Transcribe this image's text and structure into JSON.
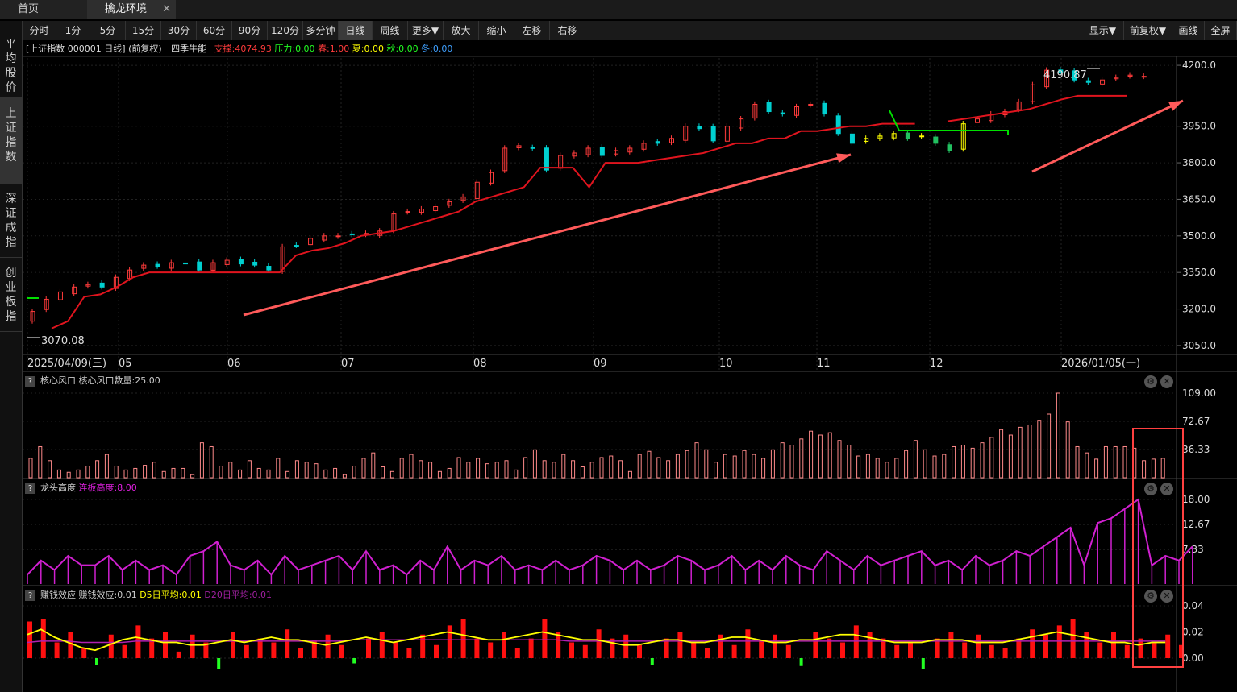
{
  "tabs": {
    "home": "首页",
    "active": "擒龙环境",
    "close": "✕"
  },
  "toolbar": {
    "left": [
      "分时",
      "1分",
      "5分",
      "15分",
      "30分",
      "60分",
      "90分",
      "120分",
      "多分钟",
      "日线",
      "周线",
      "更多▼",
      "放大",
      "缩小",
      "左移",
      "右移"
    ],
    "active": "日线",
    "right": [
      "显示▼",
      "前复权▼",
      "画线",
      "全屏"
    ]
  },
  "sidebar": [
    "平均股价",
    "上证指数",
    "深证成指",
    "创业板指"
  ],
  "sidebar_active": "上证指数",
  "main": {
    "title": "[上证指数 000001 日线] (前复权)",
    "indicator": "四季牛能",
    "support": "支撑:4074.93",
    "pressure": "压力:0.00",
    "spring": "春:1.00",
    "summer": "夏:0.00",
    "autumn": "秋:0.00",
    "winter": "冬:0.00",
    "high_label": "4190.87",
    "low_label": "3070.08",
    "y_ticks": [
      "4200.0",
      "3950.0",
      "3800.0",
      "3650.0",
      "3500.0",
      "3350.0",
      "3200.0",
      "3050.0"
    ],
    "dates": [
      "2025/04/09(三)",
      "05",
      "06",
      "07",
      "08",
      "09",
      "10",
      "11",
      "12",
      "2026/01/05(一)"
    ]
  },
  "panel1": {
    "name": "核心风口",
    "value": "核心风口数量:25.00",
    "y_ticks": [
      "109.00",
      "72.67",
      "36.33"
    ]
  },
  "panel2": {
    "name": "龙头高度",
    "value": "连板高度:8.00",
    "y_ticks": [
      "18.00",
      "12.67",
      "7.33"
    ]
  },
  "panel3": {
    "name": "赚钱效应",
    "v1": "赚钱效应:0.01",
    "v2": "D5日平均:0.01",
    "v3": "D20日平均:0.01",
    "y_ticks": [
      "0.04",
      "0.02",
      "0.00"
    ]
  },
  "help": "?",
  "icons": {
    "gear": "gear-icon",
    "close": "close-icon",
    "arrow": "arrow-left-icon"
  },
  "colors": {
    "up": "#ff3b3b",
    "down": "#00d0d0",
    "support": "#e0141e",
    "pressure": "#00e000",
    "spring": "#ff3b3b",
    "yellow": "#ffff00",
    "magenta": "#d020d0",
    "panel1": "#ff8a8a",
    "pink": "#ff6060",
    "green": "#22ff22"
  },
  "chart_data": [
    {
      "type": "candlestick",
      "title": "上证指数 000001 日线",
      "ylim": [
        3020,
        4230
      ],
      "x_labels": [
        "2025/04/09(三)",
        "05",
        "06",
        "07",
        "08",
        "09",
        "10",
        "11",
        "12",
        "2026/01/05(一)"
      ],
      "series": [
        {
          "name": "收盘价(近似)",
          "values": [
            3190,
            3240,
            3270,
            3290,
            3300,
            3290,
            3330,
            3360,
            3380,
            3375,
            3390,
            3385,
            3360,
            3390,
            3400,
            3385,
            3380,
            3360,
            3455,
            3460,
            3490,
            3500,
            3500,
            3505,
            3510,
            3520,
            3590,
            3600,
            3610,
            3620,
            3640,
            3660,
            3720,
            3760,
            3860,
            3870,
            3860,
            3770,
            3830,
            3840,
            3860,
            3830,
            3850,
            3860,
            3880,
            3880,
            3900,
            3950,
            3940,
            3890,
            3950,
            3980,
            4040,
            4010,
            4000,
            4030,
            4040,
            4000,
            3920,
            3880,
            3900,
            3910,
            3920,
            3900,
            3910,
            3880,
            3850,
            3960,
            3980,
            4000,
            4010,
            4050,
            4120,
            4180,
            4170,
            4140,
            4130,
            4140,
            4150,
            4160,
            4155
          ]
        },
        {
          "name": "四季牛能支撑",
          "values": [
            3120,
            3150,
            3250,
            3260,
            3290,
            3330,
            3350,
            3350,
            3350,
            3350,
            3350,
            3350,
            3350,
            3350,
            3350,
            3420,
            3440,
            3450,
            3470,
            3500,
            3510,
            3520,
            3540,
            3560,
            3580,
            3600,
            3640,
            3660,
            3680,
            3700,
            3780,
            3780,
            3780,
            3700,
            3800,
            3800,
            3800,
            3810,
            3820,
            3830,
            3840,
            3860,
            3880,
            3880,
            3900,
            3900,
            3930,
            3930,
            3940,
            3950,
            3950,
            3960,
            3960,
            3960,
            3970,
            3970,
            3980,
            3990,
            4000,
            4010,
            4020,
            4040,
            4060,
            4075,
            4075,
            4075,
            4075
          ]
        }
      ]
    },
    {
      "type": "bar",
      "title": "核心风口",
      "ylim": [
        0,
        109
      ],
      "values": [
        25,
        40,
        22,
        10,
        7,
        10,
        15,
        22,
        30,
        15,
        10,
        12,
        16,
        20,
        8,
        12,
        12,
        4,
        45,
        40,
        15,
        20,
        10,
        22,
        12,
        10,
        25,
        8,
        22,
        20,
        18,
        10,
        12,
        4,
        15,
        25,
        32,
        14,
        8,
        25,
        30,
        22,
        20,
        8,
        12,
        26,
        20,
        25,
        18,
        20,
        22,
        10,
        26,
        36,
        22,
        20,
        30,
        22,
        14,
        20,
        26,
        28,
        22,
        8,
        30,
        34,
        26,
        22,
        30,
        35,
        45,
        36,
        20,
        30,
        28,
        35,
        30,
        25,
        36,
        45,
        42,
        50,
        60,
        55,
        58,
        48,
        42,
        28,
        30,
        25,
        20,
        25,
        35,
        48,
        36,
        28,
        30,
        40,
        42,
        38,
        45,
        52,
        62,
        55,
        65,
        68,
        74,
        82,
        109,
        72,
        40,
        32,
        24,
        40,
        40,
        40,
        38,
        22,
        24,
        25
      ]
    },
    {
      "type": "line",
      "title": "龙头高度",
      "ylim": [
        0,
        18
      ],
      "values": [
        2,
        5,
        3,
        6,
        4,
        4,
        6,
        3,
        5,
        3,
        4,
        2,
        6,
        7,
        9,
        4,
        3,
        5,
        2,
        6,
        3,
        4,
        5,
        6,
        3,
        7,
        3,
        4,
        2,
        5,
        3,
        8,
        3,
        5,
        4,
        6,
        3,
        4,
        3,
        5,
        3,
        4,
        6,
        5,
        3,
        5,
        3,
        4,
        6,
        5,
        3,
        4,
        6,
        3,
        5,
        3,
        6,
        4,
        3,
        7,
        5,
        3,
        6,
        4,
        5,
        6,
        7,
        4,
        5,
        3,
        6,
        4,
        5,
        7,
        6,
        8,
        10,
        12,
        4,
        13,
        14,
        16,
        18,
        4,
        6,
        5,
        8
      ]
    },
    {
      "type": "bar",
      "title": "赚钱效应",
      "ylim": [
        -0.01,
        0.04
      ],
      "series": [
        {
          "name": "赚钱效应",
          "values": [
            0.028,
            0.03,
            0.012,
            0.02,
            0.008,
            -0.005,
            0.018,
            0.01,
            0.025,
            0.015,
            0.02,
            0.005,
            0.018,
            0.012,
            -0.008,
            0.02,
            0.01,
            0.015,
            0.012,
            0.022,
            0.008,
            0.014,
            0.018,
            0.01,
            -0.004,
            0.015,
            0.02,
            0.012,
            0.008,
            0.018,
            0.01,
            0.025,
            0.03,
            0.015,
            0.012,
            0.02,
            0.008,
            0.015,
            0.03,
            0.02,
            0.012,
            0.01,
            0.022,
            0.015,
            0.018,
            0.01,
            -0.005,
            0.015,
            0.02,
            0.012,
            0.008,
            0.018,
            0.01,
            0.022,
            0.014,
            0.018,
            0.01,
            -0.006,
            0.02,
            0.015,
            0.012,
            0.025,
            0.02,
            0.015,
            0.01,
            0.012,
            -0.008,
            0.015,
            0.02,
            0.012,
            0.018,
            0.01,
            0.008,
            0.015,
            0.022,
            0.018,
            0.025,
            0.03,
            0.02,
            0.012,
            0.02,
            0.01,
            0.015,
            0.012,
            0.018,
            0.01
          ]
        },
        {
          "name": "D5日平均",
          "values": [
            0.018,
            0.022,
            0.016,
            0.012,
            0.008,
            0.006,
            0.01,
            0.014,
            0.016,
            0.014,
            0.012,
            0.012,
            0.01,
            0.01,
            0.012,
            0.014,
            0.012,
            0.014,
            0.016,
            0.014,
            0.014,
            0.012,
            0.01,
            0.012,
            0.014,
            0.016,
            0.014,
            0.012,
            0.014,
            0.016,
            0.018,
            0.02,
            0.018,
            0.016,
            0.014,
            0.014,
            0.016,
            0.018,
            0.02,
            0.018,
            0.016,
            0.014,
            0.014,
            0.012,
            0.01,
            0.01,
            0.012,
            0.014,
            0.014,
            0.012,
            0.012,
            0.014,
            0.016,
            0.016,
            0.014,
            0.012,
            0.012,
            0.014,
            0.014,
            0.016,
            0.018,
            0.018,
            0.016,
            0.014,
            0.012,
            0.012,
            0.012,
            0.014,
            0.014,
            0.014,
            0.012,
            0.012,
            0.012,
            0.014,
            0.016,
            0.018,
            0.02,
            0.018,
            0.016,
            0.014,
            0.012,
            0.012,
            0.01,
            0.012,
            0.012
          ]
        },
        {
          "name": "D20日平均",
          "values": [
            0.012,
            0.013,
            0.013,
            0.013,
            0.012,
            0.012,
            0.012,
            0.012,
            0.013,
            0.013,
            0.013,
            0.013,
            0.013,
            0.013,
            0.013,
            0.013,
            0.013,
            0.013,
            0.013,
            0.013,
            0.013,
            0.013,
            0.013,
            0.013,
            0.014,
            0.014,
            0.014,
            0.014,
            0.014,
            0.014,
            0.014,
            0.014,
            0.014,
            0.014,
            0.014,
            0.014,
            0.014,
            0.014,
            0.014,
            0.014,
            0.013,
            0.013,
            0.013,
            0.013,
            0.013,
            0.013,
            0.013,
            0.013,
            0.013,
            0.013,
            0.013,
            0.013,
            0.013,
            0.013,
            0.013,
            0.013,
            0.013,
            0.013,
            0.013,
            0.013,
            0.013,
            0.013,
            0.013,
            0.013,
            0.013,
            0.013,
            0.013,
            0.013,
            0.013,
            0.013,
            0.013,
            0.013,
            0.013,
            0.013,
            0.013,
            0.013,
            0.013,
            0.013,
            0.013,
            0.013,
            0.013,
            0.013,
            0.013,
            0.013,
            0.013
          ]
        }
      ]
    }
  ]
}
